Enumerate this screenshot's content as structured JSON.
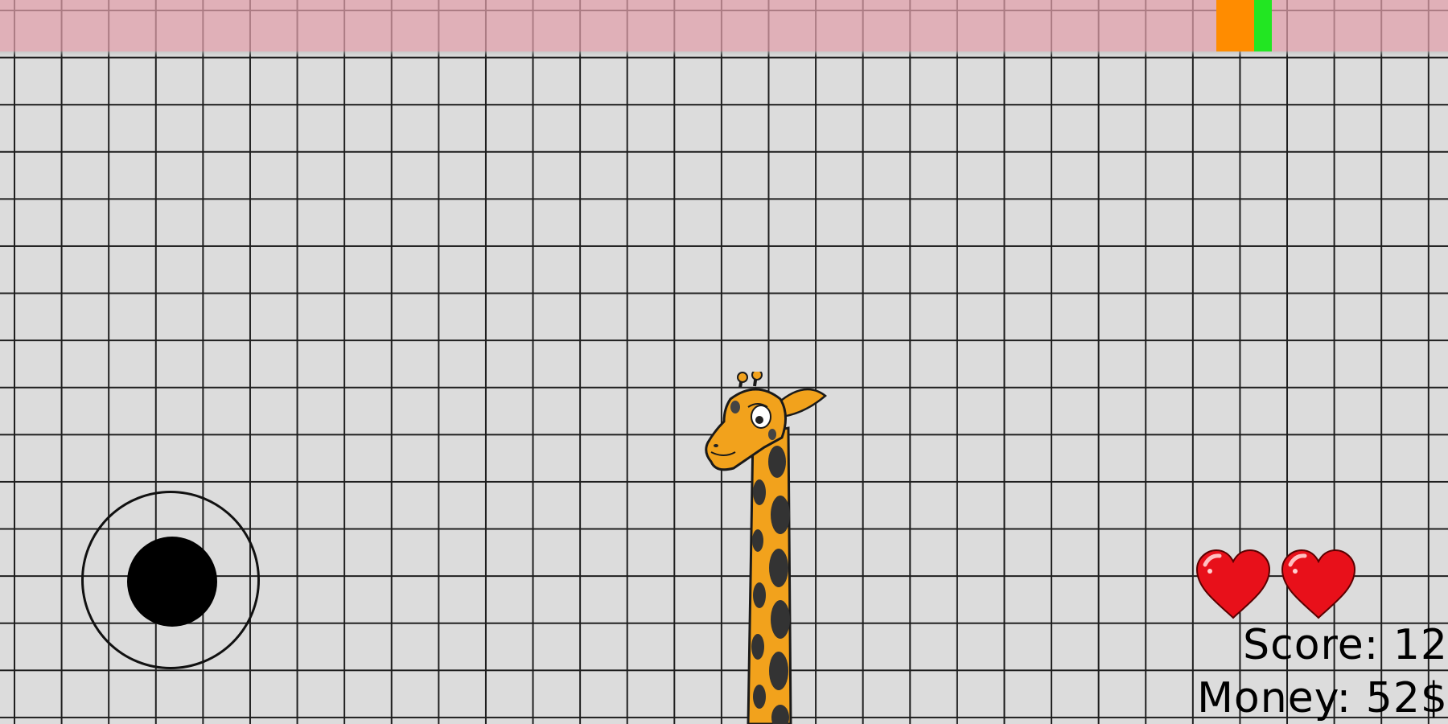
{
  "hud": {
    "score_label": "Score:",
    "score_value": "12",
    "money_label": "Money:",
    "money_value": "52$",
    "lives": 2
  },
  "top_indicators": {
    "orange_color": "#ff8c00",
    "green_color": "#22e622"
  },
  "colors": {
    "background": "#dcdcdc",
    "grid_lines": "#1e1e1e",
    "top_zone": "#e2a0aa",
    "heart": "#e8101a",
    "joystick": "#000000",
    "giraffe_body": "#f2a21c",
    "giraffe_spots": "#333333"
  },
  "icons": {
    "joystick": "virtual-joystick",
    "player": "giraffe",
    "life": "heart-icon"
  }
}
